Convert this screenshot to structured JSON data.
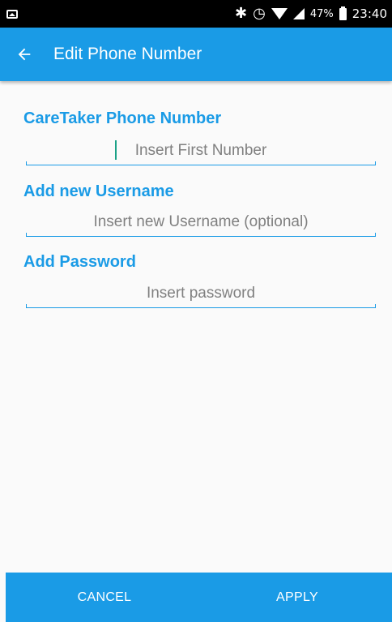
{
  "status_bar": {
    "battery": "47%",
    "time": "23:40"
  },
  "app_bar": {
    "title": "Edit Phone Number",
    "back_icon": "arrow-back-icon"
  },
  "form": {
    "caretaker": {
      "label": "CareTaker Phone Number",
      "placeholder": "Insert First Number",
      "value": ""
    },
    "username": {
      "label": "Add new Username",
      "placeholder": "Insert new Username (optional)",
      "value": ""
    },
    "password": {
      "label": "Add Password",
      "placeholder": "Insert password",
      "value": ""
    }
  },
  "actions": {
    "cancel_label": "CANCEL",
    "apply_label": "APPLY"
  },
  "colors": {
    "primary": "#1a9be6",
    "caret": "#1aa186",
    "background": "#fafafa"
  }
}
